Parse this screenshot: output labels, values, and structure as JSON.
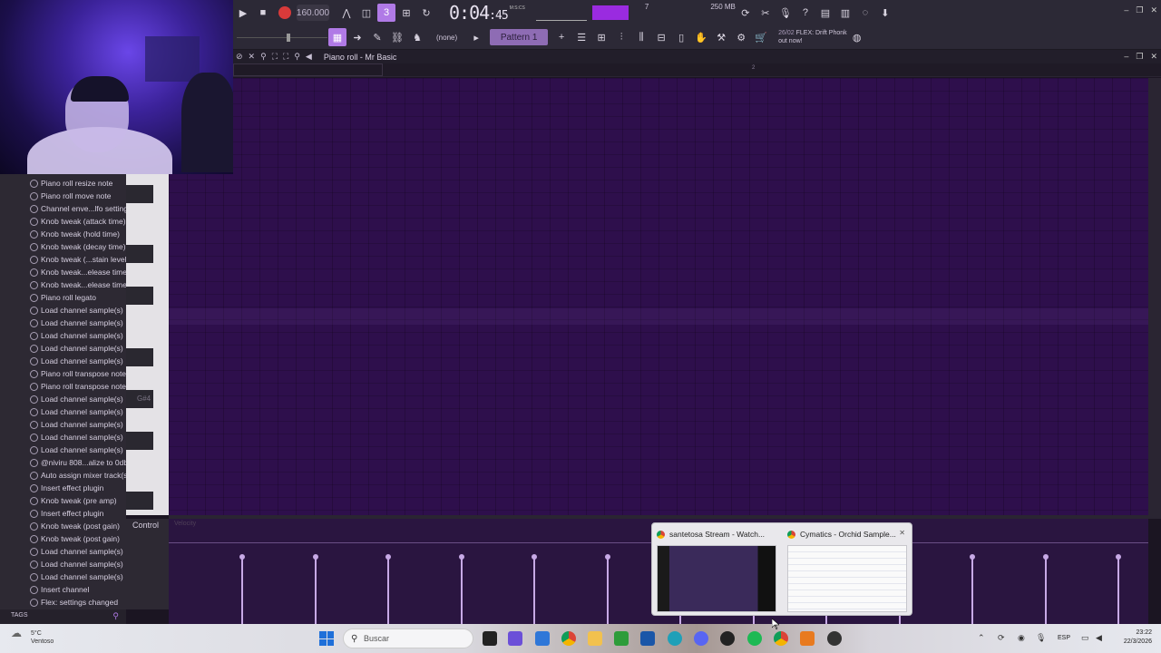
{
  "toolbar": {
    "bpm": "160.000",
    "time_main": "0:04",
    "time_sub": ":45",
    "time_caption": "M:S:CS",
    "cpu_left": "7",
    "cpu_right": "250 MB",
    "cpu_right2": "3",
    "pattern": "Pattern 1",
    "none_label": "(none)",
    "news_date": "26/02",
    "news_text": "FLEX: Drift Phonk",
    "news_sub": "out now!"
  },
  "piano_roll": {
    "title": "Piano roll - Mr Basic",
    "ruler_mark": "2",
    "key_label": "G#4",
    "control_label": "Control",
    "control_sub": "Velocity"
  },
  "history": [
    "Piano roll resize note",
    "Piano roll move note",
    "Channel enve...lfo settings",
    "Knob tweak (attack time)",
    "Knob tweak (hold time)",
    "Knob tweak (decay time)",
    "Knob tweak (...stain level)",
    "Knob tweak...elease time)",
    "Knob tweak...elease time)",
    "Piano roll legato",
    "Load channel sample(s)",
    "Load channel sample(s)",
    "Load channel sample(s)",
    "Load channel sample(s)",
    "Load channel sample(s)",
    "Piano roll transpose note",
    "Piano roll transpose note",
    "Load channel sample(s)",
    "Load channel sample(s)",
    "Load channel sample(s)",
    "Load channel sample(s)",
    "Load channel sample(s)",
    "@niviru 808...alize to 0db",
    "Auto assign mixer track(s)",
    "Insert effect plugin",
    "Knob tweak (pre amp)",
    "Insert effect plugin",
    "Knob tweak (post gain)",
    "Knob tweak (post gain)",
    "Load channel sample(s)",
    "Load channel sample(s)",
    "Load channel sample(s)",
    "Insert channel",
    "Flex: settings changed"
  ],
  "tags_label": "TAGS",
  "thumbnails": [
    {
      "title": "santetosa Stream - Watch..."
    },
    {
      "title": "Cymatics - Orchid Sample..."
    }
  ],
  "taskbar": {
    "weather_temp": "5°C",
    "weather_desc": "Ventoso",
    "search_placeholder": "Buscar",
    "lang": "ESP",
    "time": "23:22",
    "date": "22/3/2026"
  },
  "velocity": [
    0.8,
    0.8,
    0.8,
    0.8,
    0.8,
    0.8,
    0.8,
    0.8,
    0.8,
    0.8,
    0.8,
    0.8,
    0.8,
    0.8
  ]
}
